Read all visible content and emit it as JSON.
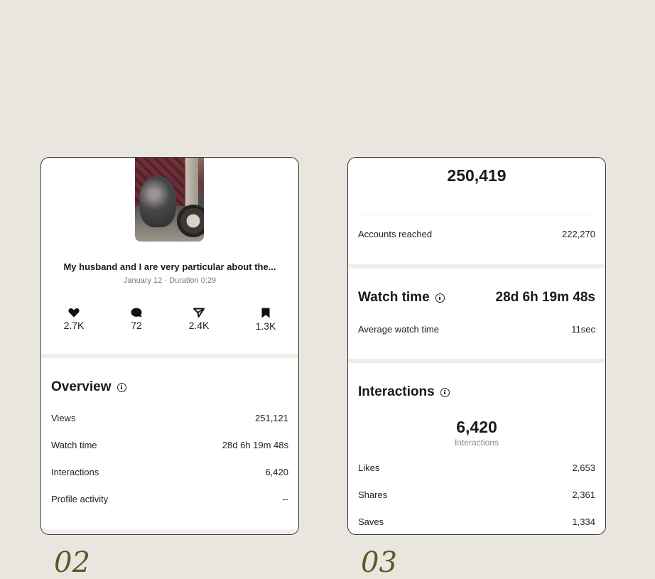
{
  "left_card": {
    "caption": "My husband and I are very particular about the...",
    "subcaption": "January 12 · Duration 0:29",
    "stats": [
      {
        "icon": "heart-icon",
        "value": "2.7K"
      },
      {
        "icon": "comment-icon",
        "value": "72"
      },
      {
        "icon": "share-icon",
        "value": "2.4K"
      },
      {
        "icon": "bookmark-icon",
        "value": "1.3K"
      }
    ],
    "overview": {
      "title": "Overview",
      "rows": [
        {
          "label": "Views",
          "value": "251,121"
        },
        {
          "label": "Watch time",
          "value": "28d 6h 19m 48s"
        },
        {
          "label": "Interactions",
          "value": "6,420"
        },
        {
          "label": "Profile activity",
          "value": "--"
        }
      ]
    }
  },
  "right_card": {
    "top_value": "250,419",
    "accounts_reached": {
      "label": "Accounts reached",
      "value": "222,270"
    },
    "watch_time": {
      "title": "Watch time",
      "value": "28d 6h 19m 48s",
      "avg_label": "Average watch time",
      "avg_value": "11sec"
    },
    "interactions": {
      "title": "Interactions",
      "total": "6,420",
      "total_label": "Interactions",
      "rows": [
        {
          "label": "Likes",
          "value": "2,653"
        },
        {
          "label": "Shares",
          "value": "2,361"
        },
        {
          "label": "Saves",
          "value": "1,334"
        }
      ]
    }
  },
  "footer": {
    "left_number": "02",
    "right_number": "03"
  },
  "colors": {
    "background": "#e9e6df",
    "card": "#ffffff",
    "accent_footer": "#5a5a2a"
  }
}
